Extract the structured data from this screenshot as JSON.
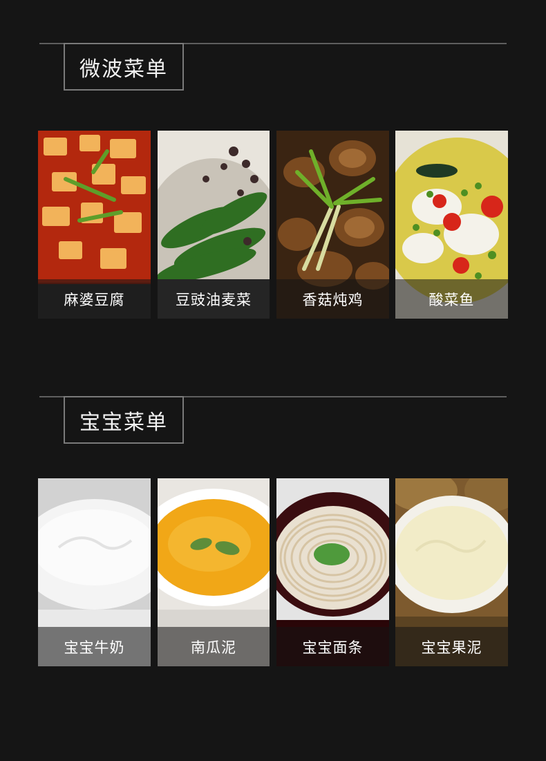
{
  "sections": [
    {
      "title": "微波菜单",
      "items": [
        {
          "label": "麻婆豆腐",
          "icon": "mapo-tofu-photo"
        },
        {
          "label": "豆豉油麦菜",
          "icon": "lettuce-photo"
        },
        {
          "label": "香菇炖鸡",
          "icon": "mushroom-chicken-photo"
        },
        {
          "label": "酸菜鱼",
          "icon": "pickled-fish-photo"
        }
      ]
    },
    {
      "title": "宝宝菜单",
      "items": [
        {
          "label": "宝宝牛奶",
          "icon": "milk-photo"
        },
        {
          "label": "南瓜泥",
          "icon": "pumpkin-puree-photo"
        },
        {
          "label": "宝宝面条",
          "icon": "noodles-photo"
        },
        {
          "label": "宝宝果泥",
          "icon": "fruit-puree-photo"
        }
      ]
    }
  ]
}
